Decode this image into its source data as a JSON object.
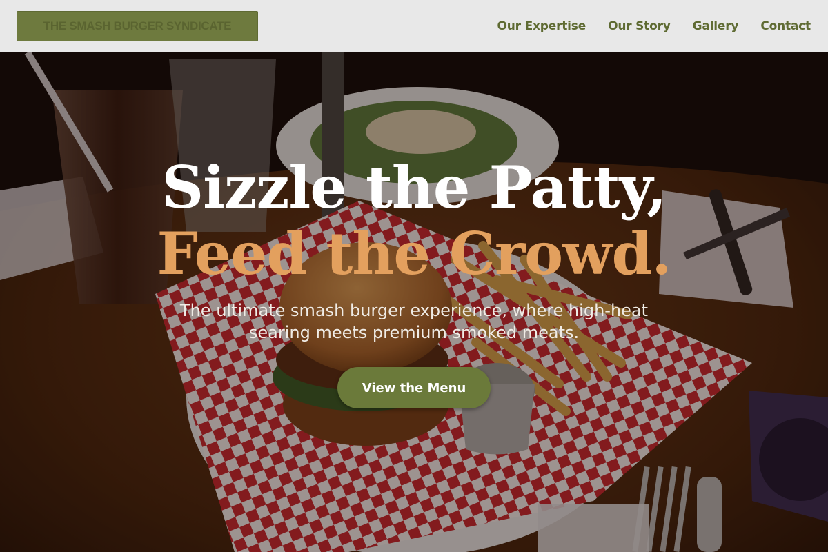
{
  "header": {
    "logo_text": "THE SMASH BURGER SYNDICATE",
    "nav": [
      {
        "label": "Our Expertise"
      },
      {
        "label": "Our Story"
      },
      {
        "label": "Gallery"
      },
      {
        "label": "Contact"
      }
    ]
  },
  "hero": {
    "title_line1": "Sizzle the Patty,",
    "title_line2": "Feed the Crowd.",
    "subtitle": "The ultimate smash burger experience, where high-heat searing meets premium smoked meats.",
    "cta_label": "View the Menu",
    "background_alt": "Burger with fries in a red checkered paper basket on a wooden table"
  },
  "colors": {
    "header_bg": "#e8e8e8",
    "brand_olive": "#6b7a3a",
    "accent_orange": "#e3a05e",
    "title_white": "#ffffff"
  }
}
